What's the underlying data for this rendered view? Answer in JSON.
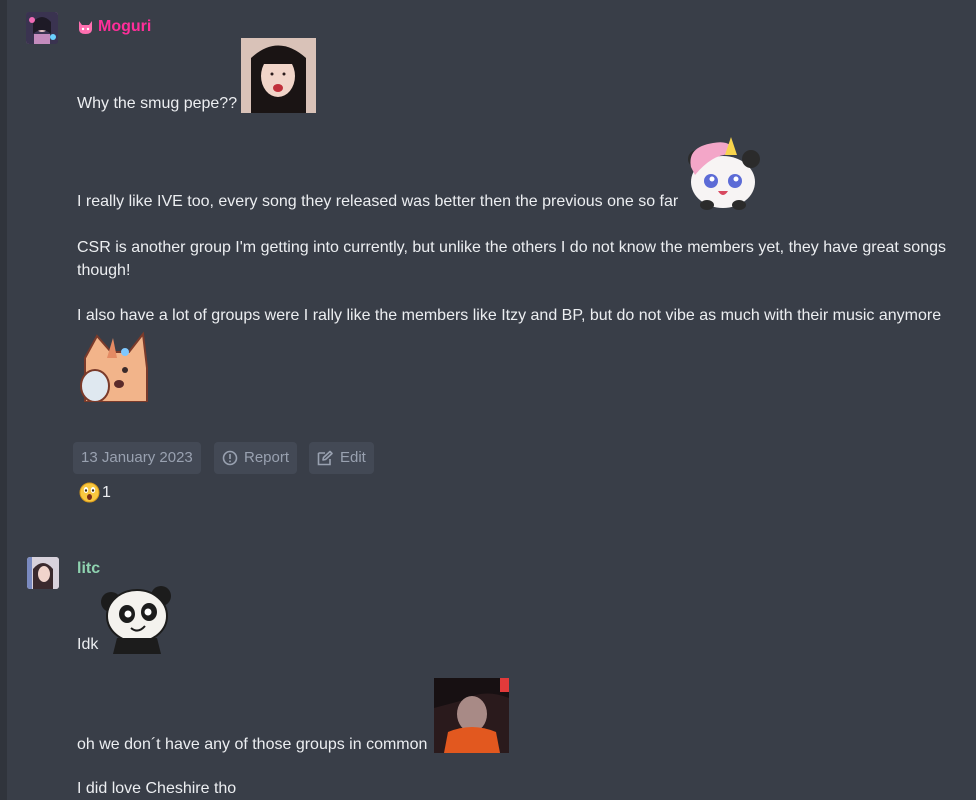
{
  "posts": [
    {
      "author": "Moguri",
      "author_color": "#ff2e9a",
      "badge_icon": "pink-cat-badge-icon",
      "paragraphs": [
        "Why the smug pepe??",
        "I really like IVE too, every song they released was better then the previous one so far",
        "CSR is another group I'm getting into currently, but unlike the others I do not know the members yet, they have great songs though!",
        "I also have a lot of groups were I rally like the members like Itzy and BP, but do not vibe as much with their music anymore"
      ],
      "actions": {
        "date": "13 January 2023",
        "report": "Report",
        "edit": "Edit"
      },
      "reaction": {
        "emoji": "astonished-face",
        "count": "1"
      }
    },
    {
      "author": "litc",
      "author_color": "#8fd3b0",
      "paragraphs": [
        "Idk",
        "oh we don´t have any of those groups in common",
        "I did love Cheshire tho"
      ]
    }
  ]
}
